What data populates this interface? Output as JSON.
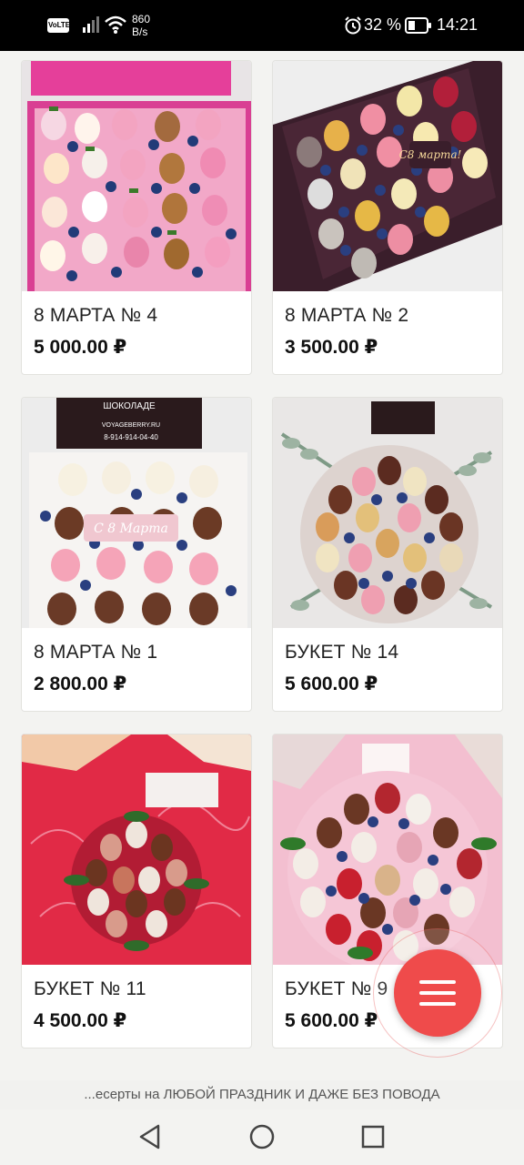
{
  "status_bar": {
    "network_badge": "VoLTE",
    "speed_value": "860",
    "speed_unit": "B/s",
    "battery_pct": "32 %",
    "time": "14:21"
  },
  "products": [
    {
      "name": "8 МАРТА № 4",
      "price": "5 000.00 ₽"
    },
    {
      "name": "8 МАРТА № 2",
      "price": "3 500.00 ₽"
    },
    {
      "name": "8 МАРТА № 1",
      "price": "2 800.00 ₽"
    },
    {
      "name": "БУКЕТ № 14",
      "price": "5 600.00 ₽"
    },
    {
      "name": "БУКЕТ № 11",
      "price": "4 500.00 ₽"
    },
    {
      "name": "БУКЕТ № 9",
      "price": "5 600.00 ₽"
    }
  ],
  "promo_text": "...есерты на ЛЮБОЙ ПРАЗДНИК И ДАЖЕ БЕЗ ПОВОДА",
  "photo_text": {
    "card1_banner": "ШОКОЛАДЕ",
    "card1_site": "VOYAGEBERRY.RU",
    "card1_phone": "8-914-914-04-40",
    "card1_sign": "С 8 Марта",
    "card2_sign": "С8 марта!"
  },
  "colors": {
    "accent": "#ef4b4b",
    "page_bg": "#f3f3f1",
    "status_bar_bg": "#000000"
  },
  "icons": {
    "fab": "menu-icon",
    "nav_back": "back-triangle-icon",
    "nav_home": "home-circle-icon",
    "nav_recents": "recents-square-icon"
  }
}
